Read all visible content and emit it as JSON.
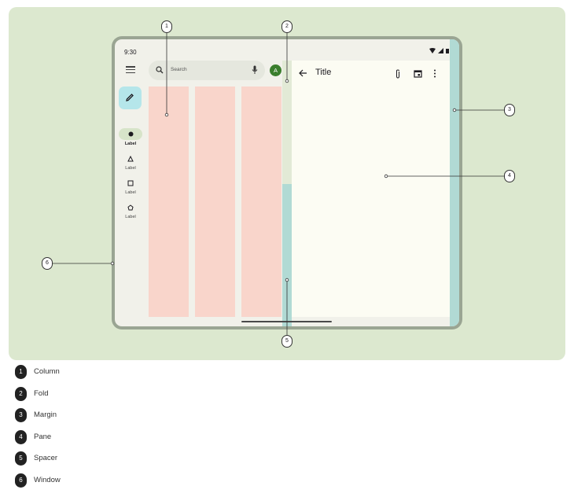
{
  "status_bar": {
    "time": "9:30",
    "icons": [
      "wifi-icon",
      "signal-icon",
      "battery-icon"
    ]
  },
  "nav_rail": {
    "menu_icon": "menu-icon",
    "fab_icon": "pencil-icon",
    "items": [
      {
        "icon": "circle-icon",
        "label": "Label",
        "active": true
      },
      {
        "icon": "triangle-icon",
        "label": "Label",
        "active": false
      },
      {
        "icon": "square-icon",
        "label": "Label",
        "active": false
      },
      {
        "icon": "pentagon-icon",
        "label": "Label",
        "active": false
      }
    ]
  },
  "search": {
    "placeholder": "Search",
    "icon": "search-icon",
    "mic_icon": "mic-icon"
  },
  "avatar": {
    "initial": "A"
  },
  "pane": {
    "title": "Title",
    "back_icon": "arrow-back-icon",
    "tools": [
      "attach-icon",
      "calendar-icon",
      "more-vert-icon"
    ]
  },
  "callouts": [
    "1",
    "2",
    "3",
    "4",
    "5",
    "6"
  ],
  "legend": [
    {
      "num": "1",
      "label": "Column"
    },
    {
      "num": "2",
      "label": "Fold"
    },
    {
      "num": "3",
      "label": "Margin"
    },
    {
      "num": "4",
      "label": "Pane"
    },
    {
      "num": "5",
      "label": "Spacer"
    },
    {
      "num": "6",
      "label": "Window"
    }
  ],
  "colors": {
    "panel_bg": "#dce8cf",
    "column": "#f9d5cb",
    "spacer_margin": "#b1dad4",
    "pane": "#fcfcf3",
    "fab": "#b5e6ea",
    "avatar": "#3a7e2d"
  }
}
